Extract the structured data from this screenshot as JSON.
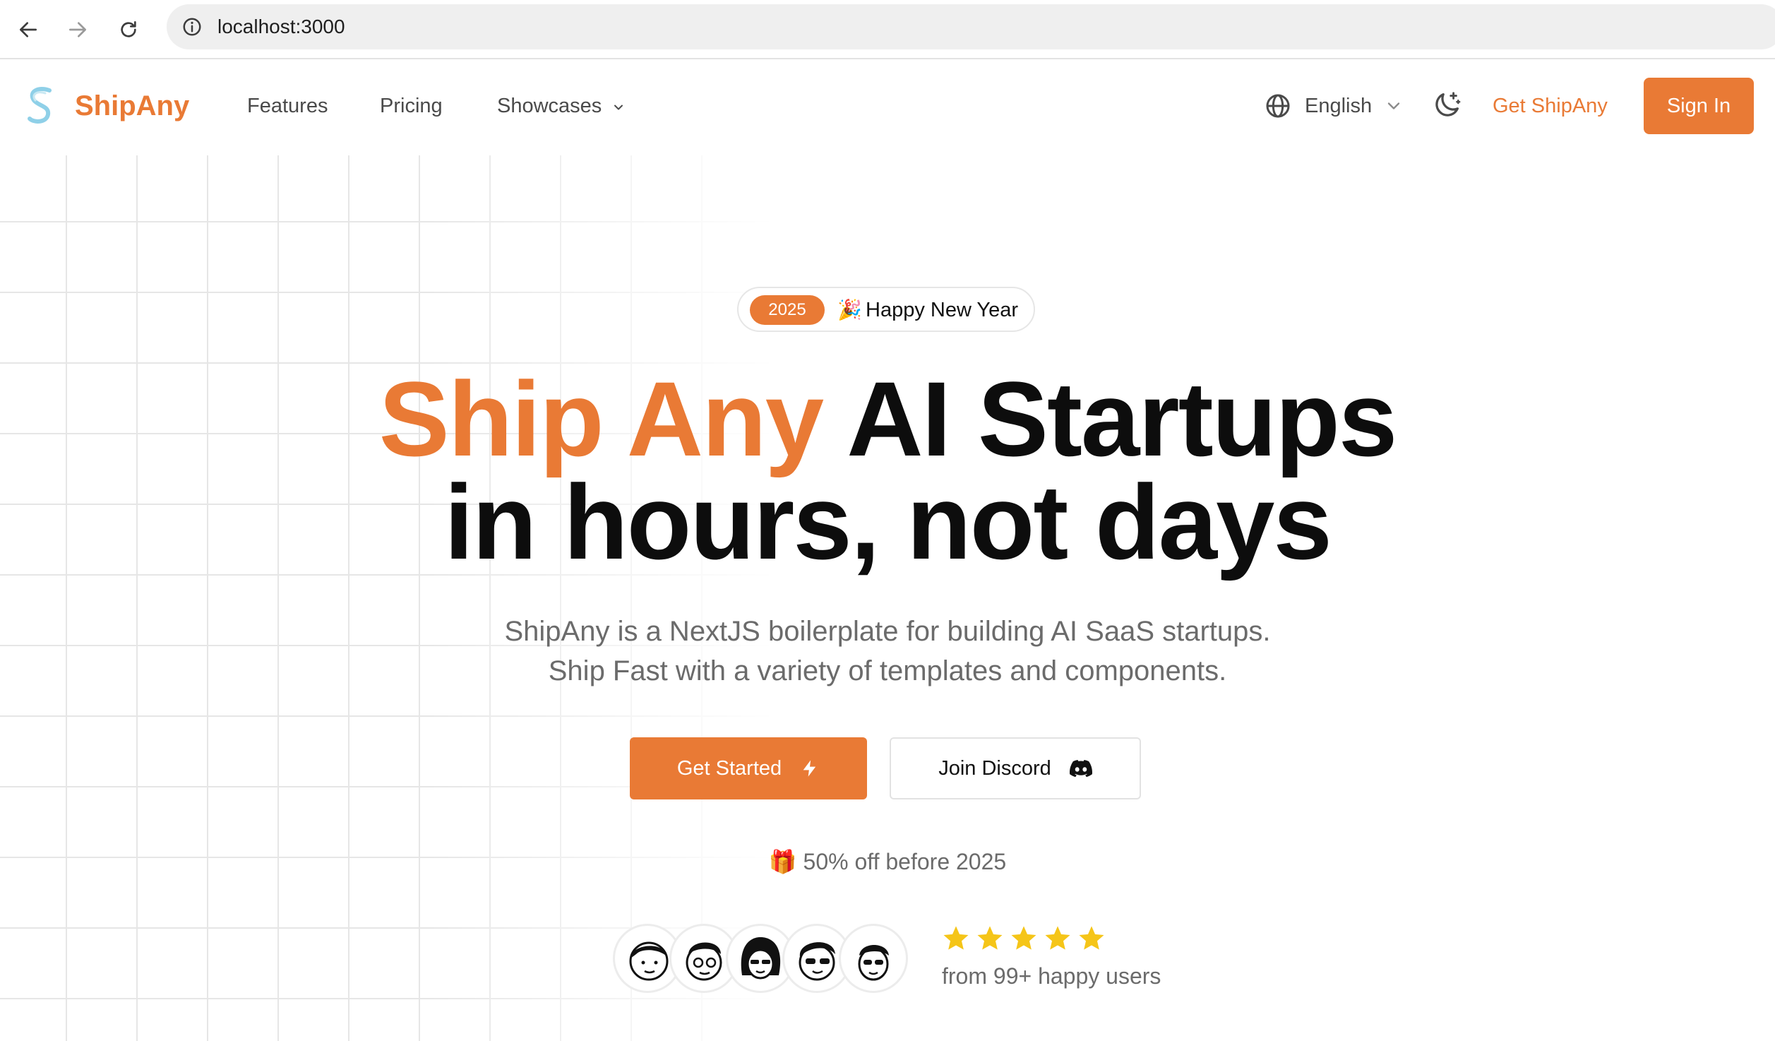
{
  "browser": {
    "url": "localhost:3000"
  },
  "header": {
    "logo_text": "ShipAny",
    "nav": {
      "features": "Features",
      "pricing": "Pricing",
      "showcases": "Showcases"
    },
    "language": "English",
    "get_link": "Get ShipAny",
    "sign_in": "Sign In"
  },
  "hero": {
    "badge_year": "2025",
    "badge_emoji": "🎉",
    "badge_text": "Happy New Year",
    "headline_accent": "Ship Any",
    "headline_rest": "AI Startups",
    "headline_line2": "in hours, not days",
    "subtitle_line1": "ShipAny is a NextJS boilerplate for building AI SaaS startups.",
    "subtitle_line2": "Ship Fast with a variety of templates and components.",
    "primary_cta": "Get Started",
    "secondary_cta": "Join Discord",
    "offer_emoji": "🎁",
    "offer_text": "50% off before 2025",
    "rating_stars": 5,
    "rating_text": "from 99+ happy users"
  },
  "colors": {
    "accent": "#e97a35",
    "star": "#f5c518",
    "text_dark": "#0d0d0d",
    "text_muted": "#6b6b6b"
  },
  "icons": {
    "back": "arrow-left-icon",
    "forward": "arrow-right-icon",
    "reload": "reload-icon",
    "site_info": "info-icon",
    "logo": "shipany-logo-icon",
    "showcases_dropdown": "chevron-down-icon",
    "language": "globe-icon",
    "language_dropdown": "chevron-down-icon",
    "theme": "moon-stars-icon",
    "primary_cta": "lightning-icon",
    "secondary_cta": "discord-icon"
  }
}
